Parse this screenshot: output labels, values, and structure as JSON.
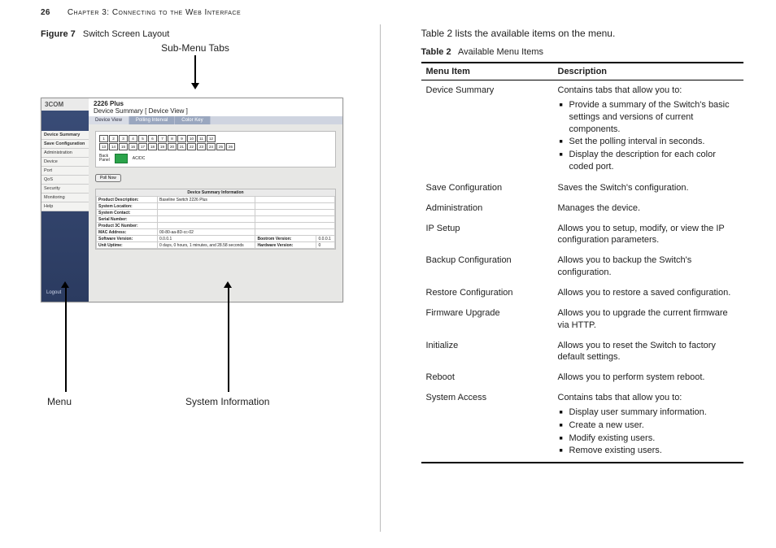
{
  "header": {
    "page_number": "26",
    "chapter_title": "Chapter 3: Connecting to the Web Interface"
  },
  "left": {
    "figure_label": "Figure 7",
    "figure_title": "Switch Screen Layout",
    "callout_top": "Sub-Menu Tabs",
    "callout_menu": "Menu",
    "callout_sysinfo": "System Information",
    "screenshot": {
      "logo": "3COM",
      "window_title_bold": "2226 Plus",
      "window_title_rest": "Device Summary [ Device View ]",
      "menu_items": [
        "Device Summary",
        "Save Configuration",
        "Administration",
        "Device",
        "Port",
        "QoS",
        "Security",
        "Monitoring",
        "Help"
      ],
      "logout": "Logout",
      "tabs": [
        "Device View",
        "Polling Interval",
        "Color Key"
      ],
      "ports_top": [
        "1",
        "2",
        "3",
        "4",
        "5",
        "6",
        "7",
        "8",
        "9",
        "10",
        "11",
        "12"
      ],
      "ports_bottom": [
        "13",
        "14",
        "15",
        "16",
        "17",
        "18",
        "19",
        "20",
        "21",
        "22",
        "23",
        "24",
        "25",
        "26"
      ],
      "back_panel": "Back\nPanel",
      "acdc": "AC/DC",
      "poll_now": "Poll Now",
      "info_header": "Device Summary Information",
      "info_rows": [
        [
          "Product Description:",
          "Baseline Switch 2226 Plus"
        ],
        [
          "System Location:",
          ""
        ],
        [
          "System Contact:",
          ""
        ],
        [
          "Serial Number:",
          ""
        ],
        [
          "Product 3C Number:",
          ""
        ],
        [
          "MAC Address:",
          "00-80-aa-8D-cc-02"
        ],
        [
          "Software Version:",
          "0.0.0.1"
        ],
        [
          "Unit Uptime:",
          "0 days, 0 hours, 1 minutes, and 28.58 seconds"
        ]
      ],
      "right_labels": [
        "Bootrom Version:",
        "Hardware Version:"
      ],
      "right_values": [
        "0.0.0.1",
        "0"
      ]
    }
  },
  "right": {
    "lead": "Table 2 lists the available items on the menu.",
    "table_label": "Table 2",
    "table_title": "Available Menu Items",
    "columns": [
      "Menu Item",
      "Description"
    ],
    "rows": [
      {
        "item": "Device Summary",
        "desc": "Contains tabs that allow you to:",
        "bullets": [
          "Provide a summary of the Switch's basic settings and versions of current components.",
          "Set the polling interval in seconds.",
          "Display the description for each color coded port."
        ]
      },
      {
        "item": "Save Configuration",
        "desc": "Saves the Switch's configuration."
      },
      {
        "item": "Administration",
        "desc": "Manages the device."
      },
      {
        "item": "IP Setup",
        "indent": true,
        "desc": "Allows you to setup, modify, or view the IP configuration parameters."
      },
      {
        "item": "Backup Configuration",
        "indent": true,
        "desc": "Allows you to backup the Switch's configuration."
      },
      {
        "item": "Restore Configuration",
        "indent": true,
        "desc": "Allows you to restore a saved configuration."
      },
      {
        "item": "Firmware Upgrade",
        "indent": true,
        "desc": "Allows you to upgrade the current firmware via HTTP."
      },
      {
        "item": "Initialize",
        "indent": true,
        "desc": "Allows you to reset the Switch to factory default settings."
      },
      {
        "item": "Reboot",
        "indent": true,
        "desc": "Allows you to perform system reboot."
      },
      {
        "item": "System Access",
        "indent": true,
        "desc": "Contains tabs that allow you to:",
        "bullets": [
          "Display user summary information.",
          "Create a new user.",
          "Modify existing users.",
          "Remove existing users."
        ]
      }
    ]
  }
}
